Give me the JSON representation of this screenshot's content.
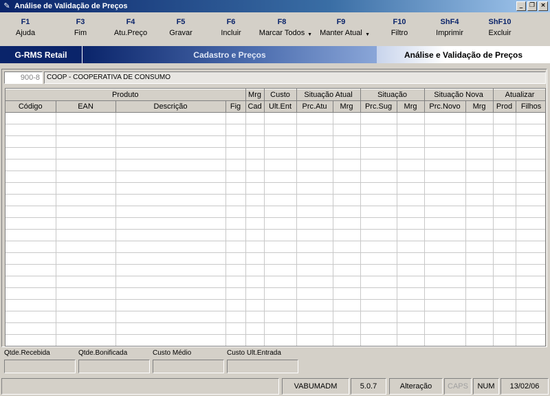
{
  "window": {
    "title": "Análise de Validação de Preços",
    "buttons": [
      "_",
      "❐",
      "×"
    ]
  },
  "toolbar": {
    "keys": [
      {
        "key": "F1",
        "label": "Ajuda"
      },
      {
        "key": "F3",
        "label": "Fim"
      },
      {
        "key": "F4",
        "label": "Atu.Preço"
      },
      {
        "key": "F5",
        "label": "Gravar"
      },
      {
        "key": "F6",
        "label": "Incluir"
      },
      {
        "key": "F8",
        "label": "Marcar Todos"
      },
      {
        "key": "F9",
        "label": "Manter Atual"
      },
      {
        "key": "F10",
        "label": "Filtro"
      },
      {
        "key": "ShF4",
        "label": "Imprimir"
      },
      {
        "key": "ShF10",
        "label": "Excluir"
      }
    ]
  },
  "banner": {
    "brand": "G-RMS Retail",
    "module": "Cadastro e Preços",
    "screen": "Análise e Validação de Preços"
  },
  "company": {
    "code": "900-8",
    "name": "COOP - COOPERATIVA DE CONSUMO"
  },
  "grid": {
    "groups": [
      {
        "label": "Produto",
        "span": 4
      },
      {
        "label": "Mrg",
        "span": 1
      },
      {
        "label": "Custo",
        "span": 1
      },
      {
        "label": "Situação Atual",
        "span": 2
      },
      {
        "label": "Situação",
        "span": 2
      },
      {
        "label": "Situação Nova",
        "span": 2
      },
      {
        "label": "Atualizar",
        "span": 2
      }
    ],
    "columns": [
      "Código",
      "EAN",
      "Descrição",
      "Fig",
      "Cad",
      "Ult.Ent",
      "Prc.Atu",
      "Mrg",
      "Prc.Sug",
      "Mrg",
      "Prc.Novo",
      "Mrg",
      "Prod",
      "Filhos"
    ],
    "rows": []
  },
  "summary": {
    "qtde_recebida_label": "Qtde.Recebida",
    "qtde_bonificada_label": "Qtde.Bonificada",
    "custo_medio_label": "Custo Médio",
    "custo_ult_entrada_label": "Custo Ult.Entrada"
  },
  "status": {
    "user": "VABUMADM",
    "version": "5.0.7",
    "mode": "Alteração",
    "caps": "CAPS",
    "num": "NUM",
    "date": "13/02/06"
  }
}
